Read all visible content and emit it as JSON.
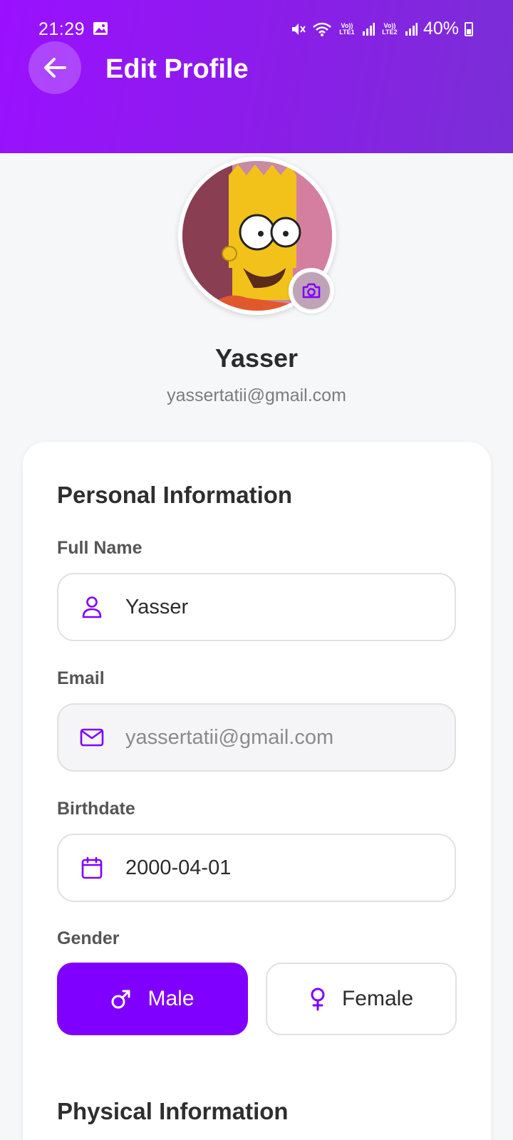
{
  "status_bar": {
    "time": "21:29",
    "battery": "40%",
    "sim1": "Vo)) LTE1",
    "sim2": "Vo)) LTE2"
  },
  "header": {
    "title": "Edit Profile"
  },
  "profile": {
    "name": "Yasser",
    "email": "yassertatii@gmail.com"
  },
  "personal_section": {
    "title": "Personal Information",
    "full_name": {
      "label": "Full Name",
      "value": "Yasser"
    },
    "email": {
      "label": "Email",
      "value": "yassertatii@gmail.com"
    },
    "birthdate": {
      "label": "Birthdate",
      "value": "2000-04-01"
    },
    "gender": {
      "label": "Gender",
      "options": [
        "Male",
        "Female"
      ],
      "selected": "Male"
    }
  },
  "physical_section": {
    "title": "Physical Information"
  },
  "colors": {
    "primary": "#8000ff",
    "header_gradient_start": "#9a10ff",
    "header_gradient_end": "#7a2fd6"
  },
  "icons": {
    "back": "arrow-left-icon",
    "camera": "camera-icon",
    "full_name": "user-icon",
    "email": "mail-icon",
    "birthdate": "calendar-icon",
    "male": "male-symbol-icon",
    "female": "female-symbol-icon"
  }
}
